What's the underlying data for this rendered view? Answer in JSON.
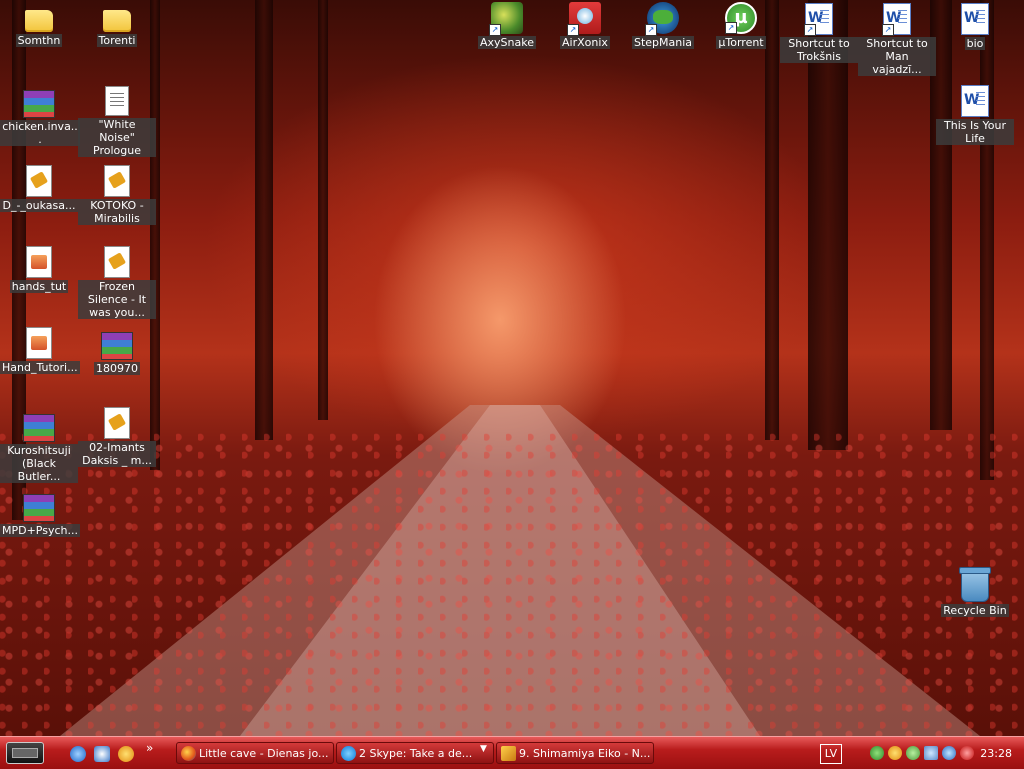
{
  "desktop": {
    "icons": [
      {
        "label": "Somthn",
        "type": "folder"
      },
      {
        "label": "Torenti",
        "type": "folder"
      },
      {
        "label": "chicken.inva...",
        "type": "rar"
      },
      {
        "label": "\"White Noise\" Prologue",
        "type": "doc"
      },
      {
        "label": "D_-_oukasa...",
        "type": "media"
      },
      {
        "label": "KOTOKO - Mirabilis",
        "type": "media"
      },
      {
        "label": "hands_tut",
        "type": "image"
      },
      {
        "label": "Frozen Silence - It was you...",
        "type": "media"
      },
      {
        "label": "Hand_Tutori...",
        "type": "image"
      },
      {
        "label": "180970",
        "type": "rar"
      },
      {
        "label": "Kuroshitsuji (Black Butler...",
        "type": "rar"
      },
      {
        "label": "02-Imants Daksis _ m...",
        "type": "media"
      },
      {
        "label": "MPD+Psych...",
        "type": "rar"
      },
      {
        "label": "AxySnake",
        "type": "app-shortcut"
      },
      {
        "label": "AirXonix",
        "type": "app-shortcut"
      },
      {
        "label": "StepMania",
        "type": "app-shortcut"
      },
      {
        "label": "µTorrent",
        "type": "app-shortcut"
      },
      {
        "label": "Shortcut to Trokšnis",
        "type": "word-shortcut"
      },
      {
        "label": "Shortcut to Man vajadzī...",
        "type": "word-shortcut"
      },
      {
        "label": "bio",
        "type": "word"
      },
      {
        "label": "This Is Your Life",
        "type": "word"
      },
      {
        "label": "Recycle Bin",
        "type": "recycle-bin"
      }
    ]
  },
  "taskbar": {
    "quick_launch_more": "»",
    "tasks": [
      {
        "label": "Little cave - Dienas jo...",
        "icon": "firefox-icon"
      },
      {
        "label": "2 Skype: Take a de...",
        "icon": "skype-icon"
      },
      {
        "label": "9. Shimamiya Eiko - N...",
        "icon": "media-player-icon"
      }
    ],
    "task_group_arrow": "▼",
    "language": "LV",
    "clock": "23:28"
  },
  "colors": {
    "taskbar_top": "#e85a5a",
    "taskbar_bottom": "#9a1010",
    "label_bg": "#3c3c3c"
  }
}
